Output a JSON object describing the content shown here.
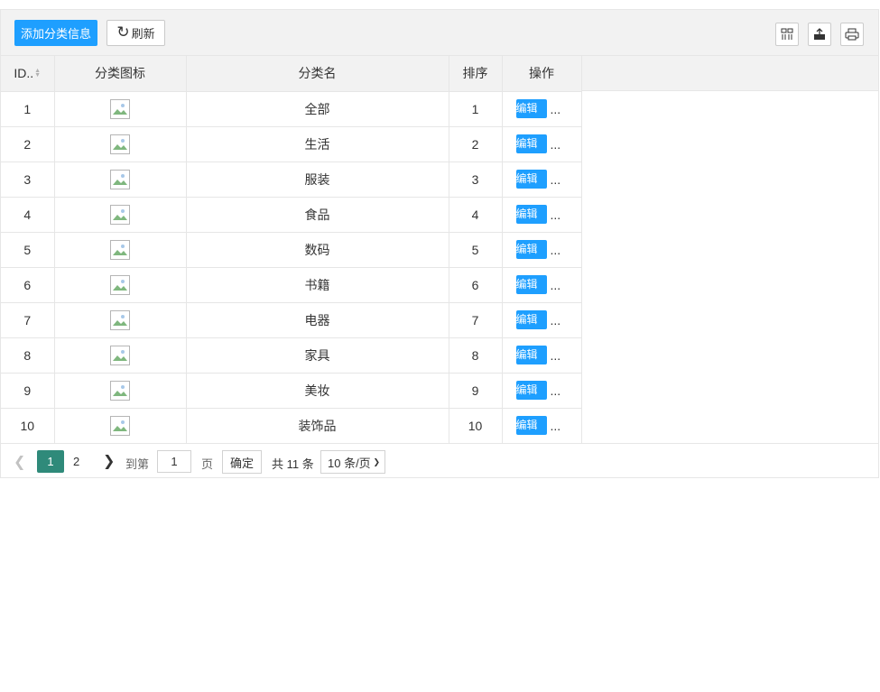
{
  "toolbar": {
    "add_label": "添加分类信息",
    "refresh_label": "刷新",
    "refresh_icon": "refresh-icon",
    "right_icons": [
      "columns-filter-icon",
      "export-icon",
      "print-icon"
    ]
  },
  "table": {
    "headers": {
      "id": "ID..",
      "icon": "分类图标",
      "name": "分类名",
      "sort": "排序",
      "ops": "操作"
    },
    "edit_label": "编辑",
    "more_label": "...",
    "rows": [
      {
        "id": "1",
        "name": "全部",
        "sort": "1"
      },
      {
        "id": "2",
        "name": "生活",
        "sort": "2"
      },
      {
        "id": "3",
        "name": "服装",
        "sort": "3"
      },
      {
        "id": "4",
        "name": "食品",
        "sort": "4"
      },
      {
        "id": "5",
        "name": "数码",
        "sort": "5"
      },
      {
        "id": "6",
        "name": "书籍",
        "sort": "6"
      },
      {
        "id": "7",
        "name": "电器",
        "sort": "7"
      },
      {
        "id": "8",
        "name": "家具",
        "sort": "8"
      },
      {
        "id": "9",
        "name": "美妆",
        "sort": "9"
      },
      {
        "id": "10",
        "name": "装饰品",
        "sort": "10"
      }
    ]
  },
  "pagination": {
    "prev_icon": "chevron-left-icon",
    "current_page": "1",
    "other_page": "2",
    "next_icon": "chevron-right-icon",
    "goto_label": "到第",
    "goto_value": "1",
    "page_unit": "页",
    "confirm_label": "确定",
    "total_label": "共 11 条",
    "page_size_label": "10 条/页"
  },
  "colors": {
    "primary": "#1e9fff",
    "current_page": "#2f8a7a",
    "header_bg": "#f2f2f2"
  }
}
